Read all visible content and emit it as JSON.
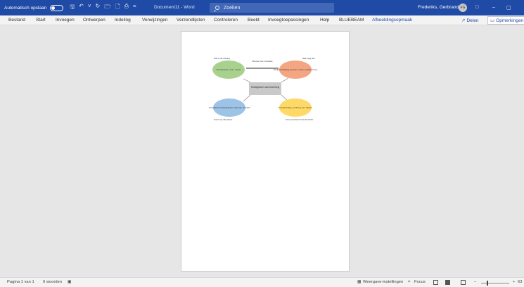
{
  "titlebar": {
    "autosave_label": "Automatisch opslaan",
    "doc_title": "Document11  -  Word",
    "search_placeholder": "Zoeken",
    "user_name": "Frederiks, Gerbrand",
    "user_initials": "FG",
    "qa_more": "="
  },
  "ribbon": {
    "tabs": [
      "Bestand",
      "Start",
      "Invoegen",
      "Ontwerpen",
      "Indeling",
      "Verwijzingen",
      "Verzendlijsten",
      "Controleren",
      "Beeld",
      "Invoegtoepassingen",
      "Help",
      "BLUEBEAM",
      "Afbeeldingsopmaak"
    ],
    "share_label": "Delen",
    "comments_label": "Opmerkingen"
  },
  "diagram": {
    "center": "Strategische samenwerking",
    "top_left": "Verrassende, visie, missie",
    "top_right": "Doelbekrachtiging, grenzen, meten, kenbare focus",
    "bottom_left": "Strategische eindoelstellingen, wiskunde, formatief",
    "bottom_right": "Procesinrichting, monitoring, ke'f, effecten",
    "arrow_label": "Ruimte voor innovatie",
    "label_tl": "Wat is de richting",
    "label_tr": "Wat mag hier",
    "label_bl": "Focus op inhoudeer",
    "label_br": "Focus op taken benoemde doelen",
    "colors": {
      "green": "#a9d18e",
      "orange": "#f4a582",
      "blue": "#9dc3e6",
      "yellow": "#ffd966",
      "center": "#c9c9c9"
    }
  },
  "statusbar": {
    "page": "Pagina 1 van 1",
    "words": "0 woorden",
    "display_settings": "Weergave-instellingen",
    "focus": "Focus",
    "zoom_minus": "−",
    "zoom_plus": "+",
    "zoom": "63"
  }
}
